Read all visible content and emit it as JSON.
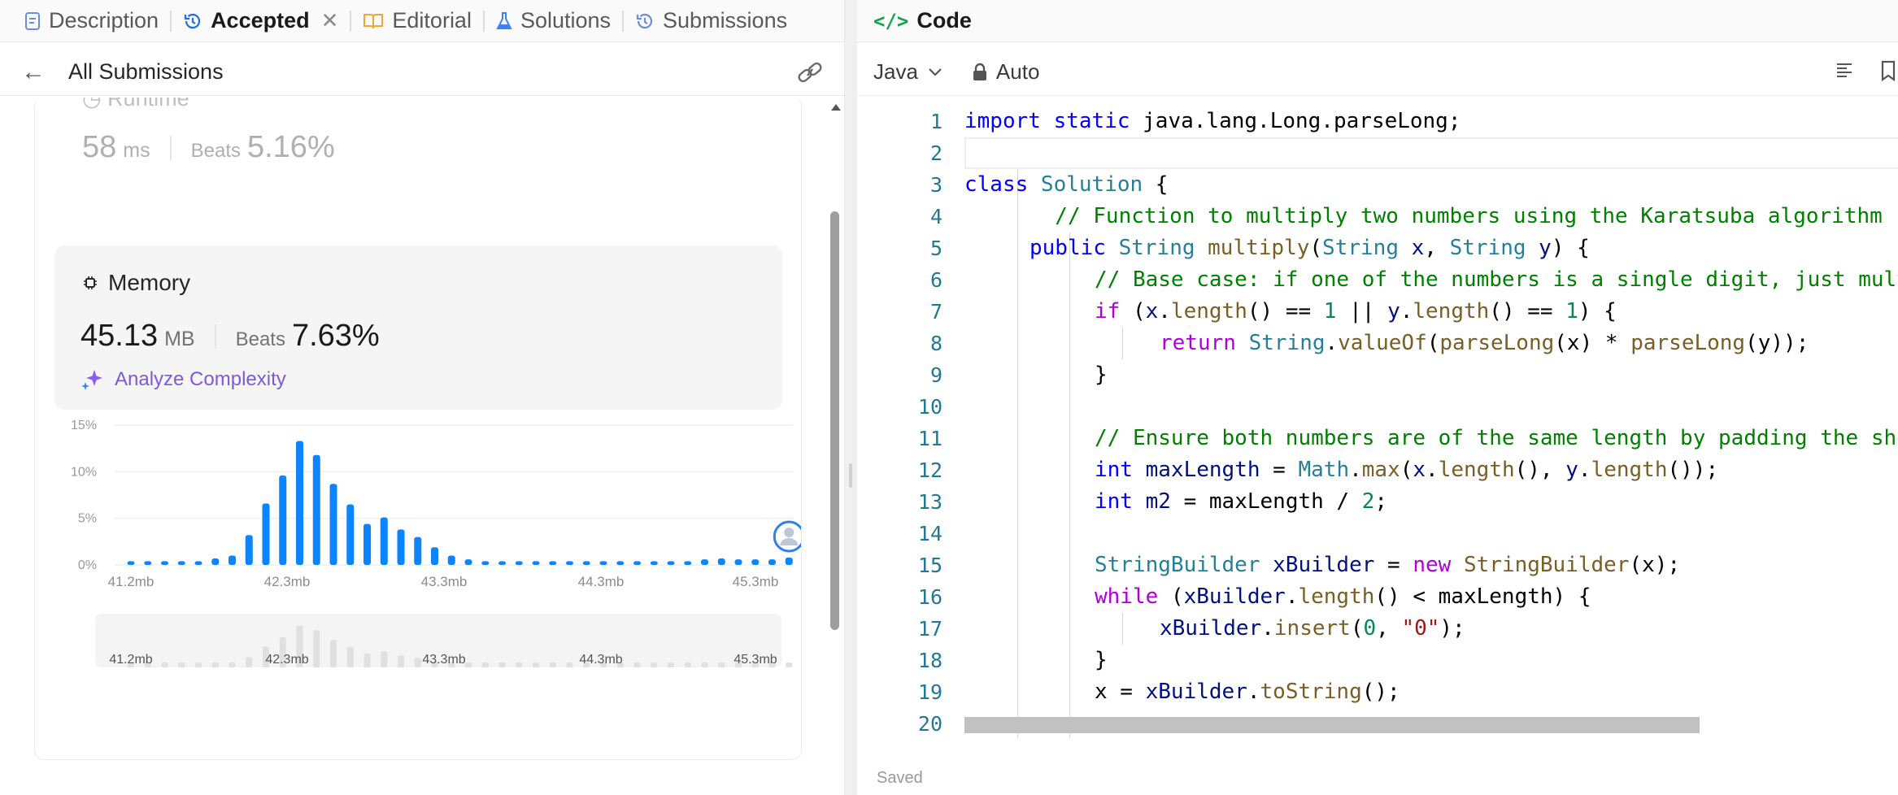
{
  "tabs": [
    {
      "label": "Description",
      "icon": "description-icon"
    },
    {
      "label": "Accepted",
      "icon": "history-icon",
      "active": true
    },
    {
      "label": "Editorial",
      "icon": "book-icon"
    },
    {
      "label": "Solutions",
      "icon": "flask-icon"
    },
    {
      "label": "Submissions",
      "icon": "history-icon"
    }
  ],
  "subheader": {
    "back_label": "All Submissions"
  },
  "runtime": {
    "label": "Runtime",
    "value": "58",
    "unit": "ms",
    "beats_label": "Beats",
    "beats": "5.16%"
  },
  "memory": {
    "label": "Memory",
    "value": "45.13",
    "unit": "MB",
    "beats_label": "Beats",
    "beats": "7.63%",
    "analyze_label": "Analyze Complexity"
  },
  "chart_data": {
    "type": "bar",
    "title": "",
    "xlabel": "",
    "ylabel": "",
    "y_ticks": [
      "15%",
      "10%",
      "5%",
      "0%"
    ],
    "ylim": [
      0,
      15
    ],
    "x_tick_labels": [
      "41.2mb",
      "42.3mb",
      "43.3mb",
      "44.3mb",
      "45.3mb"
    ],
    "values": [
      0.4,
      0.4,
      0.4,
      0.4,
      0.4,
      0.7,
      1.0,
      3.2,
      6.6,
      9.6,
      13.3,
      11.8,
      8.7,
      6.5,
      4.4,
      5.1,
      3.8,
      3.0,
      1.9,
      1.0,
      0.6,
      0.4,
      0.4,
      0.4,
      0.4,
      0.4,
      0.4,
      0.4,
      0.4,
      0.4,
      0.4,
      0.4,
      0.4,
      0.4,
      0.6,
      0.7,
      0.6,
      0.6,
      0.6,
      0.8,
      1.2
    ],
    "user_bar_index": 39,
    "colors": {
      "bar": "#0a84ff",
      "overview_bar": "#e0e0e0",
      "grid": "#efefef"
    }
  },
  "code_panel": {
    "title": "Code",
    "language": "Java",
    "mode": "Auto",
    "status": "Saved"
  },
  "code_lines": [
    {
      "n": "1",
      "indent": 0,
      "toks": [
        [
          "kw",
          "import "
        ],
        [
          "kw",
          "static "
        ],
        [
          "",
          "java.lang.Long.parseLong;"
        ]
      ]
    },
    {
      "n": "2",
      "indent": 0,
      "toks": []
    },
    {
      "n": "3",
      "indent": 0,
      "toks": [
        [
          "kw",
          "class "
        ],
        [
          "ty",
          "Solution"
        ],
        [
          "",
          " {"
        ]
      ]
    },
    {
      "n": "4",
      "indent": 1,
      "toks": [
        [
          "cm",
          "  // Function to multiply two numbers using the Karatsuba algorithm"
        ]
      ]
    },
    {
      "n": "5",
      "indent": 1,
      "toks": [
        [
          "kw",
          "public "
        ],
        [
          "ty",
          "String "
        ],
        [
          "fn",
          "multiply"
        ],
        [
          "",
          "("
        ],
        [
          "ty",
          "String "
        ],
        [
          "var",
          "x"
        ],
        [
          ", "
        ],
        [
          "ty",
          "String "
        ],
        [
          "var",
          "y"
        ],
        [
          ") {"
        ]
      ]
    },
    {
      "n": "6",
      "indent": 2,
      "toks": [
        [
          "cm",
          "// Base case: if one of the numbers is a single digit, just multiply"
        ]
      ]
    },
    {
      "n": "7",
      "indent": 2,
      "toks": [
        [
          "ctrl",
          "if "
        ],
        [
          "",
          "("
        ],
        [
          "var",
          "x"
        ],
        [
          "",
          "."
        ],
        [
          "fn",
          "length"
        ],
        [
          "",
          "() == "
        ],
        [
          "num",
          "1"
        ],
        [
          "",
          " || "
        ],
        [
          "var",
          "y"
        ],
        [
          "",
          "."
        ],
        [
          "fn",
          "length"
        ],
        [
          "",
          "() == "
        ],
        [
          "num",
          "1"
        ],
        [
          "",
          ") {"
        ]
      ]
    },
    {
      "n": "8",
      "indent": 3,
      "toks": [
        [
          "ctrl",
          "return "
        ],
        [
          "ty",
          "String"
        ],
        [
          "",
          "."
        ],
        [
          "fn",
          "valueOf"
        ],
        [
          "",
          "("
        ],
        [
          "fn",
          "parseLong"
        ],
        [
          "",
          "(x) * "
        ],
        [
          "fn",
          "parseLong"
        ],
        [
          "",
          "(y));"
        ]
      ]
    },
    {
      "n": "9",
      "indent": 2,
      "toks": [
        [
          "",
          "}"
        ]
      ]
    },
    {
      "n": "10",
      "indent": 2,
      "toks": []
    },
    {
      "n": "11",
      "indent": 2,
      "toks": [
        [
          "cm",
          "// Ensure both numbers are of the same length by padding the shorter"
        ]
      ]
    },
    {
      "n": "12",
      "indent": 2,
      "toks": [
        [
          "kw",
          "int "
        ],
        [
          "var",
          "maxLength"
        ],
        [
          "",
          " = "
        ],
        [
          "ty",
          "Math"
        ],
        [
          "",
          "."
        ],
        [
          "fn",
          "max"
        ],
        [
          "",
          "("
        ],
        [
          "var",
          "x"
        ],
        [
          "",
          "."
        ],
        [
          "fn",
          "length"
        ],
        [
          "",
          "(), "
        ],
        [
          "var",
          "y"
        ],
        [
          "",
          "."
        ],
        [
          "fn",
          "length"
        ],
        [
          "",
          "());"
        ]
      ]
    },
    {
      "n": "13",
      "indent": 2,
      "toks": [
        [
          "kw",
          "int "
        ],
        [
          "var",
          "m2"
        ],
        [
          "",
          " = maxLength / "
        ],
        [
          "num",
          "2"
        ],
        [
          "",
          ";"
        ]
      ]
    },
    {
      "n": "14",
      "indent": 2,
      "toks": []
    },
    {
      "n": "15",
      "indent": 2,
      "toks": [
        [
          "ty",
          "StringBuilder "
        ],
        [
          "var",
          "xBuilder"
        ],
        [
          "",
          " = "
        ],
        [
          "ctrl",
          "new "
        ],
        [
          "fn",
          "StringBuilder"
        ],
        [
          "",
          "(x);"
        ]
      ]
    },
    {
      "n": "16",
      "indent": 2,
      "toks": [
        [
          "ctrl",
          "while "
        ],
        [
          "",
          "("
        ],
        [
          "var",
          "xBuilder"
        ],
        [
          "",
          "."
        ],
        [
          "fn",
          "length"
        ],
        [
          "",
          "() < maxLength) {"
        ]
      ]
    },
    {
      "n": "17",
      "indent": 3,
      "toks": [
        [
          "var",
          "xBuilder"
        ],
        [
          "",
          "."
        ],
        [
          "fn",
          "insert"
        ],
        [
          "",
          "("
        ],
        [
          "num",
          "0"
        ],
        [
          ", "
        ],
        [
          "str",
          "\"0\""
        ],
        [
          "",
          ");"
        ]
      ]
    },
    {
      "n": "18",
      "indent": 2,
      "toks": [
        [
          "",
          "}"
        ]
      ]
    },
    {
      "n": "19",
      "indent": 2,
      "toks": [
        [
          "",
          "x = "
        ],
        [
          "var",
          "xBuilder"
        ],
        [
          "",
          "."
        ],
        [
          "fn",
          "toString"
        ],
        [
          "",
          "();"
        ]
      ]
    },
    {
      "n": "20",
      "indent": 0,
      "toks": []
    }
  ]
}
